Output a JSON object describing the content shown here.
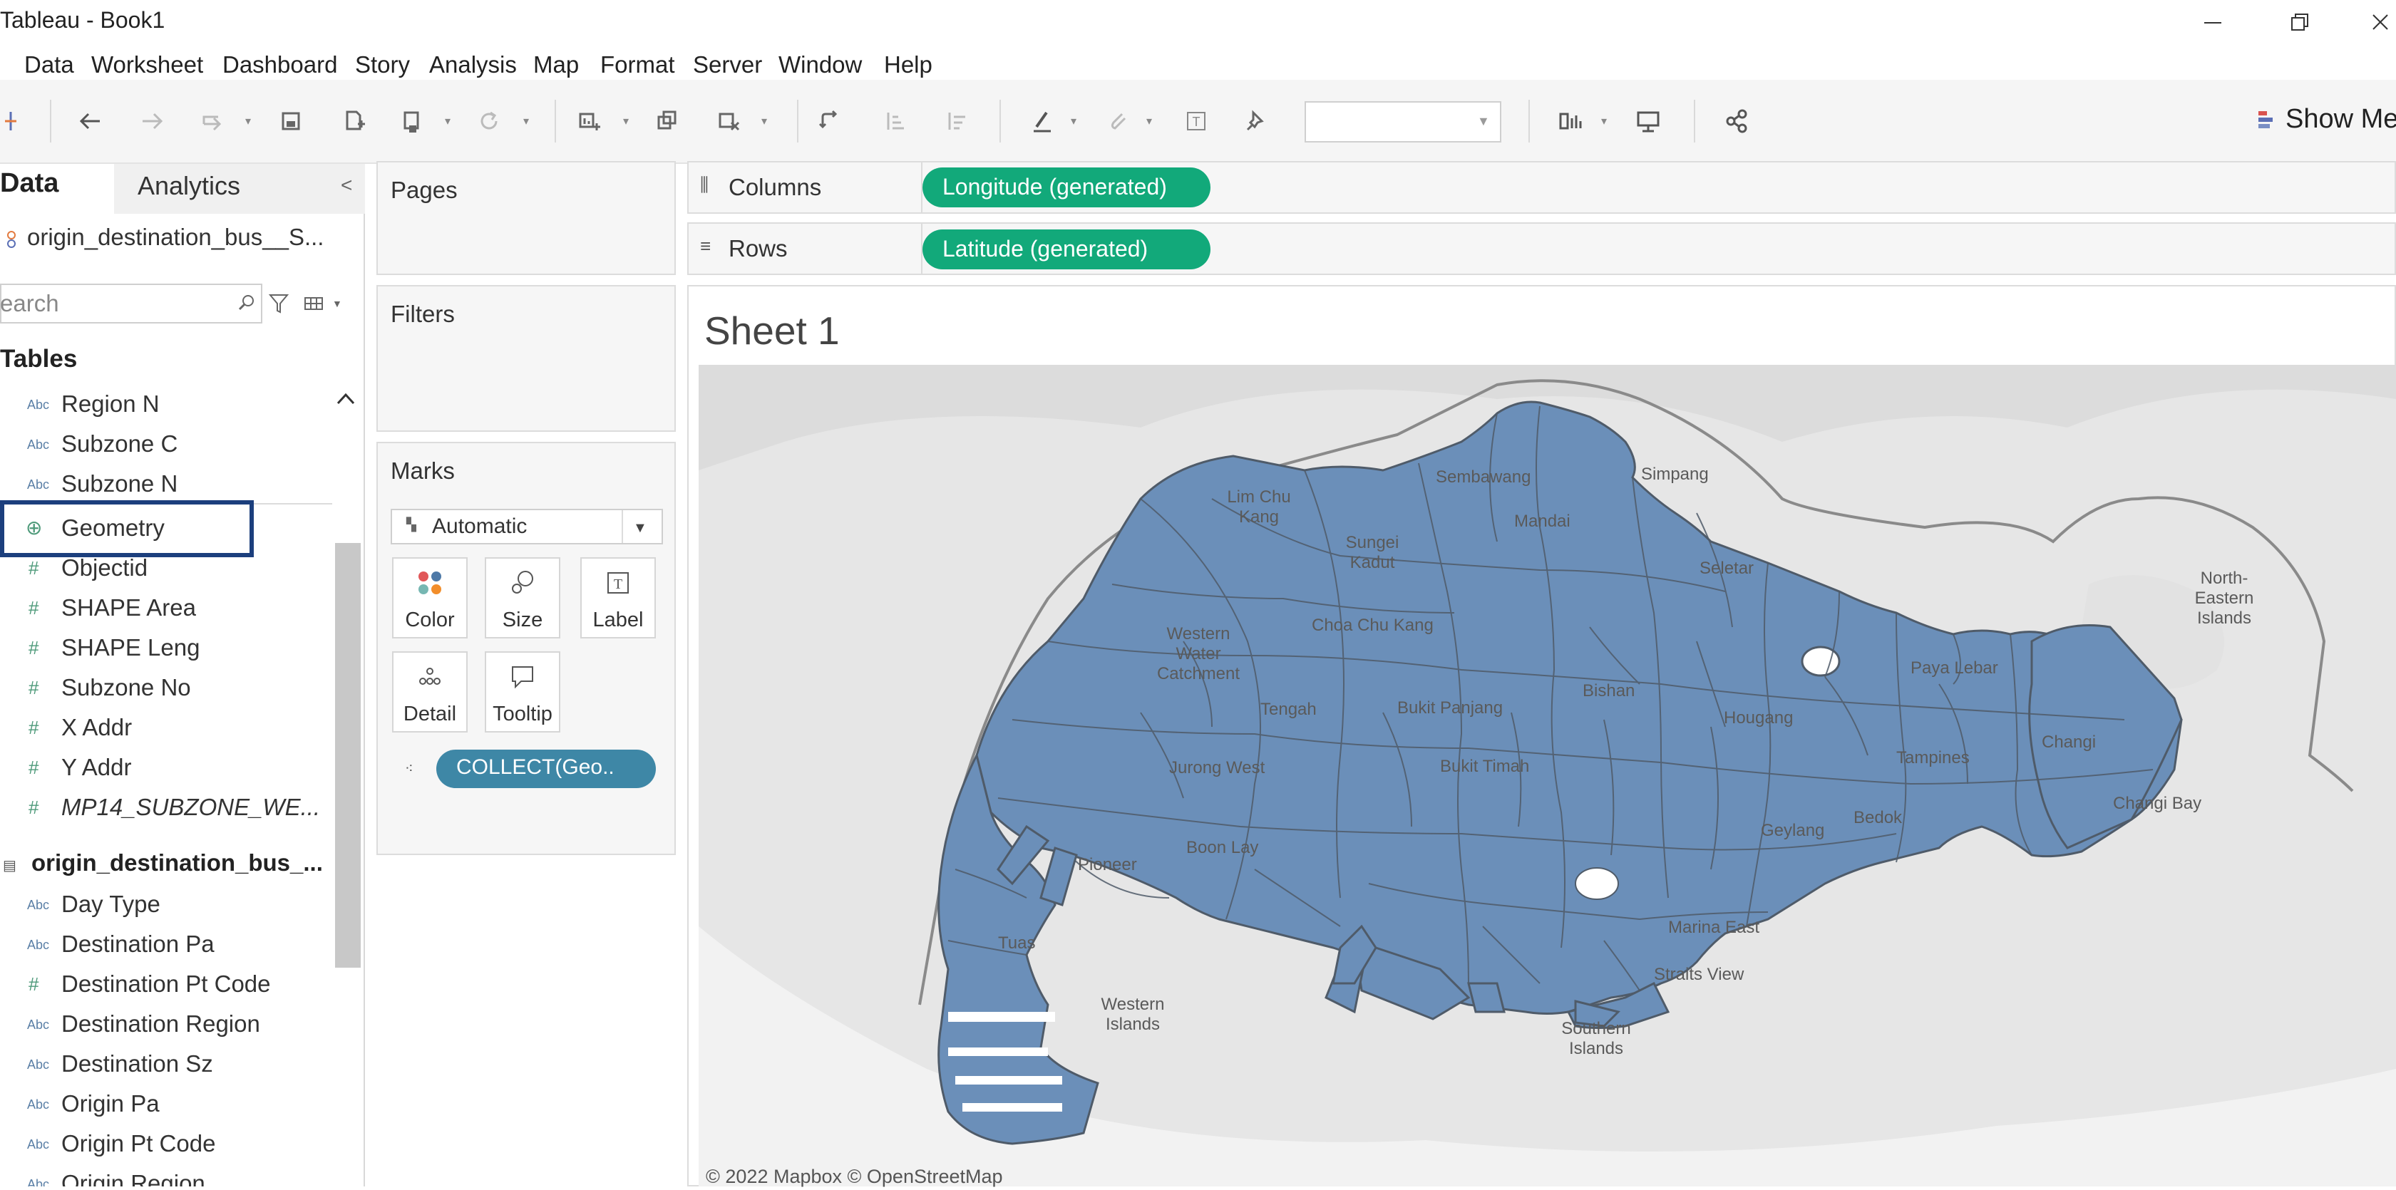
{
  "window": {
    "title": "Tableau - Book1"
  },
  "menu": [
    "Data",
    "Worksheet",
    "Dashboard",
    "Story",
    "Analysis",
    "Map",
    "Format",
    "Server",
    "Window",
    "Help"
  ],
  "toolbar": {
    "icons": [
      "tableau-logo-icon",
      "undo-icon",
      "redo-icon",
      "replay-icon",
      "save-icon",
      "new-datasource-icon",
      "pause-updates-icon",
      "refresh-icon",
      "new-worksheet-icon",
      "duplicate-sheet-icon",
      "clear-sheet-icon",
      "swap-icon",
      "sort-ascending-icon",
      "sort-descending-icon",
      "highlight-icon",
      "group-icon",
      "show-labels-icon",
      "pin-icon",
      "fit-dropdown",
      "show-cards-icon",
      "presentation-icon",
      "share-icon"
    ],
    "show_me": "Show Me"
  },
  "left_pane": {
    "tab_data": "Data",
    "tab_analytics": "Analytics",
    "collapse": "<",
    "datasource": "origin_destination_bus__S...",
    "search_placeholder": "earch",
    "tables_heading": "Tables",
    "fields_table1": [
      {
        "type": "Abc",
        "label": "Region N"
      },
      {
        "type": "Abc",
        "label": "Subzone C"
      },
      {
        "type": "Abc",
        "label": "Subzone N"
      },
      {
        "type": "geo",
        "label": "Geometry"
      },
      {
        "type": "#",
        "label": "Objectid"
      },
      {
        "type": "#",
        "label": "SHAPE Area"
      },
      {
        "type": "#",
        "label": "SHAPE Leng"
      },
      {
        "type": "#",
        "label": "Subzone No"
      },
      {
        "type": "#",
        "label": "X Addr"
      },
      {
        "type": "#",
        "label": "Y Addr"
      },
      {
        "type": "#",
        "label": "MP14_SUBZONE_WE..."
      }
    ],
    "table2_heading": "origin_destination_bus_...",
    "fields_table2": [
      {
        "type": "Abc",
        "label": "Day Type"
      },
      {
        "type": "Abc",
        "label": "Destination Pa"
      },
      {
        "type": "#",
        "label": "Destination Pt Code"
      },
      {
        "type": "Abc",
        "label": "Destination Region"
      },
      {
        "type": "Abc",
        "label": "Destination Sz"
      },
      {
        "type": "Abc",
        "label": "Origin Pa"
      },
      {
        "type": "Abc",
        "label": "Origin Pt Code"
      },
      {
        "type": "Abc",
        "label": "Origin Region"
      }
    ]
  },
  "cards": {
    "pages": "Pages",
    "filters": "Filters",
    "marks": "Marks",
    "marks_type": "Automatic",
    "mark_buttons": [
      "Color",
      "Size",
      "Label",
      "Detail",
      "Tooltip"
    ],
    "mark_pill": "COLLECT(Geo.."
  },
  "shelves": {
    "columns_label": "Columns",
    "columns_pill": "Longitude (generated)",
    "rows_label": "Rows",
    "rows_pill": "Latitude (generated)"
  },
  "sheet": {
    "title": "Sheet 1",
    "credit": "© 2022 Mapbox © OpenStreetMap",
    "fill_color": "#6b8fb9",
    "map_labels": [
      "Simpang",
      "Lim Chu Kang",
      "Sungei Kadut",
      "Western Water Catchment",
      "Tengah",
      "Sembawang",
      "Mandai",
      "Seletar",
      "Changi",
      "Changi Bay",
      "North-Eastern Islands",
      "Tuas",
      "Western Islands",
      "Southern Islands",
      "Marina East",
      "Straits View",
      "Bishan",
      "Bukit Timah",
      "Jurong West",
      "Boon Lay",
      "Pioneer",
      "Tampines",
      "Bedok",
      "Hougang",
      "Choa Chu Kang",
      "Bukit Panjang",
      "Paya Lebar",
      "Geylang"
    ]
  }
}
